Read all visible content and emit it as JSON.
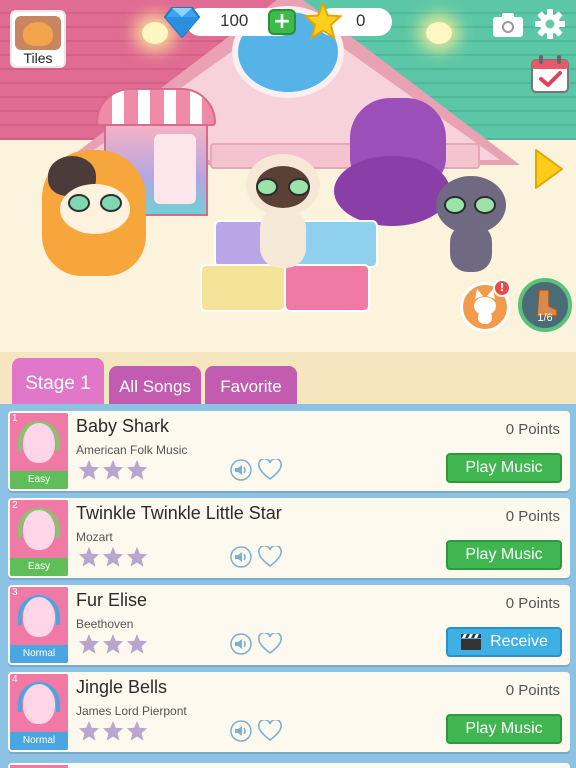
{
  "hud": {
    "tiles_label": "Tiles",
    "gems": "100",
    "plus": "+",
    "stars": "0",
    "notification_mark": "!",
    "progress": "1/6"
  },
  "tabs": [
    {
      "label": "Stage 1",
      "active": true
    },
    {
      "label": "All Songs",
      "active": false
    },
    {
      "label": "Favorite",
      "active": false
    }
  ],
  "songs": [
    {
      "num": "1",
      "title": "Baby Shark",
      "artist": "American Folk Music",
      "level": "Easy",
      "points": "0 Points",
      "action": "Play Music",
      "stars": 0
    },
    {
      "num": "2",
      "title": "Twinkle Twinkle Little Star",
      "artist": "Mozart",
      "level": "Easy",
      "points": "0 Points",
      "action": "Play Music",
      "stars": 0
    },
    {
      "num": "3",
      "title": "Fur Elise",
      "artist": "Beethoven",
      "level": "Normal",
      "points": "0 Points",
      "action": "Receive",
      "stars": 0
    },
    {
      "num": "4",
      "title": "Jingle Bells",
      "artist": "James Lord Pierpont",
      "level": "Normal",
      "points": "0 Points",
      "action": "Play Music",
      "stars": 0
    }
  ],
  "colors": {
    "tab_active": "#e077c8",
    "tab_inactive": "#c25cb0",
    "play_button": "#3fb650",
    "receive_button": "#3fb0e4",
    "easy": "#5fbe5a",
    "normal": "#4aa6e0",
    "star_empty": "#b9a6cf"
  },
  "icons": [
    "diamond-icon",
    "plus-icon",
    "star-icon",
    "camera-icon",
    "gear-icon",
    "calendar-check-icon",
    "arrow-right-icon",
    "speaker-icon",
    "heart-icon",
    "clapperboard-icon"
  ]
}
